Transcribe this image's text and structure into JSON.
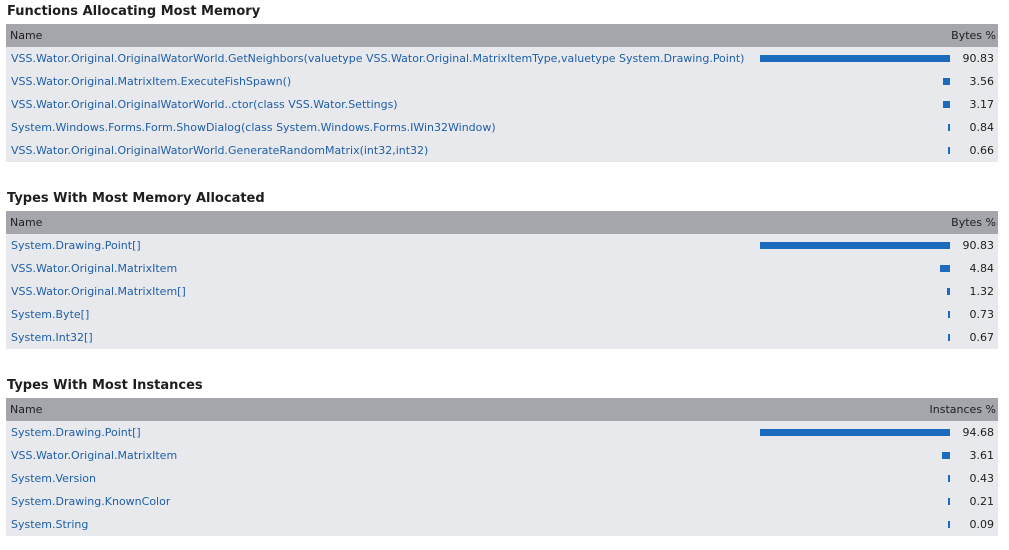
{
  "sections": [
    {
      "title": "Functions Allocating Most Memory",
      "name_header": "Name",
      "metric_header": "Bytes %",
      "rows": [
        {
          "name": "VSS.Wator.Original.OriginalWatorWorld.GetNeighbors(valuetype VSS.Wator.Original.MatrixItemType,valuetype System.Drawing.Point)",
          "value": "90.83",
          "percent": 90.83
        },
        {
          "name": "VSS.Wator.Original.MatrixItem.ExecuteFishSpawn()",
          "value": "3.56",
          "percent": 3.56
        },
        {
          "name": "VSS.Wator.Original.OriginalWatorWorld..ctor(class VSS.Wator.Settings)",
          "value": "3.17",
          "percent": 3.17
        },
        {
          "name": "System.Windows.Forms.Form.ShowDialog(class System.Windows.Forms.IWin32Window)",
          "value": "0.84",
          "percent": 0.84
        },
        {
          "name": "VSS.Wator.Original.OriginalWatorWorld.GenerateRandomMatrix(int32,int32)",
          "value": "0.66",
          "percent": 0.66
        }
      ]
    },
    {
      "title": "Types With Most Memory Allocated",
      "name_header": "Name",
      "metric_header": "Bytes %",
      "rows": [
        {
          "name": "System.Drawing.Point[]",
          "value": "90.83",
          "percent": 90.83
        },
        {
          "name": "VSS.Wator.Original.MatrixItem",
          "value": "4.84",
          "percent": 4.84
        },
        {
          "name": "VSS.Wator.Original.MatrixItem[]",
          "value": "1.32",
          "percent": 1.32
        },
        {
          "name": "System.Byte[]",
          "value": "0.73",
          "percent": 0.73
        },
        {
          "name": "System.Int32[]",
          "value": "0.67",
          "percent": 0.67
        }
      ]
    },
    {
      "title": "Types With Most Instances",
      "name_header": "Name",
      "metric_header": "Instances %",
      "rows": [
        {
          "name": "System.Drawing.Point[]",
          "value": "94.68",
          "percent": 94.68
        },
        {
          "name": "VSS.Wator.Original.MatrixItem",
          "value": "3.61",
          "percent": 3.61
        },
        {
          "name": "System.Version",
          "value": "0.43",
          "percent": 0.43
        },
        {
          "name": "System.Drawing.KnownColor",
          "value": "0.21",
          "percent": 0.21
        },
        {
          "name": "System.String",
          "value": "0.09",
          "percent": 0.09
        }
      ]
    }
  ],
  "colors": {
    "link": "#1f5fa8",
    "bar": "#1c6bbd",
    "header_bg": "#a5a6ab",
    "row_bg": "#e8e9ec"
  }
}
